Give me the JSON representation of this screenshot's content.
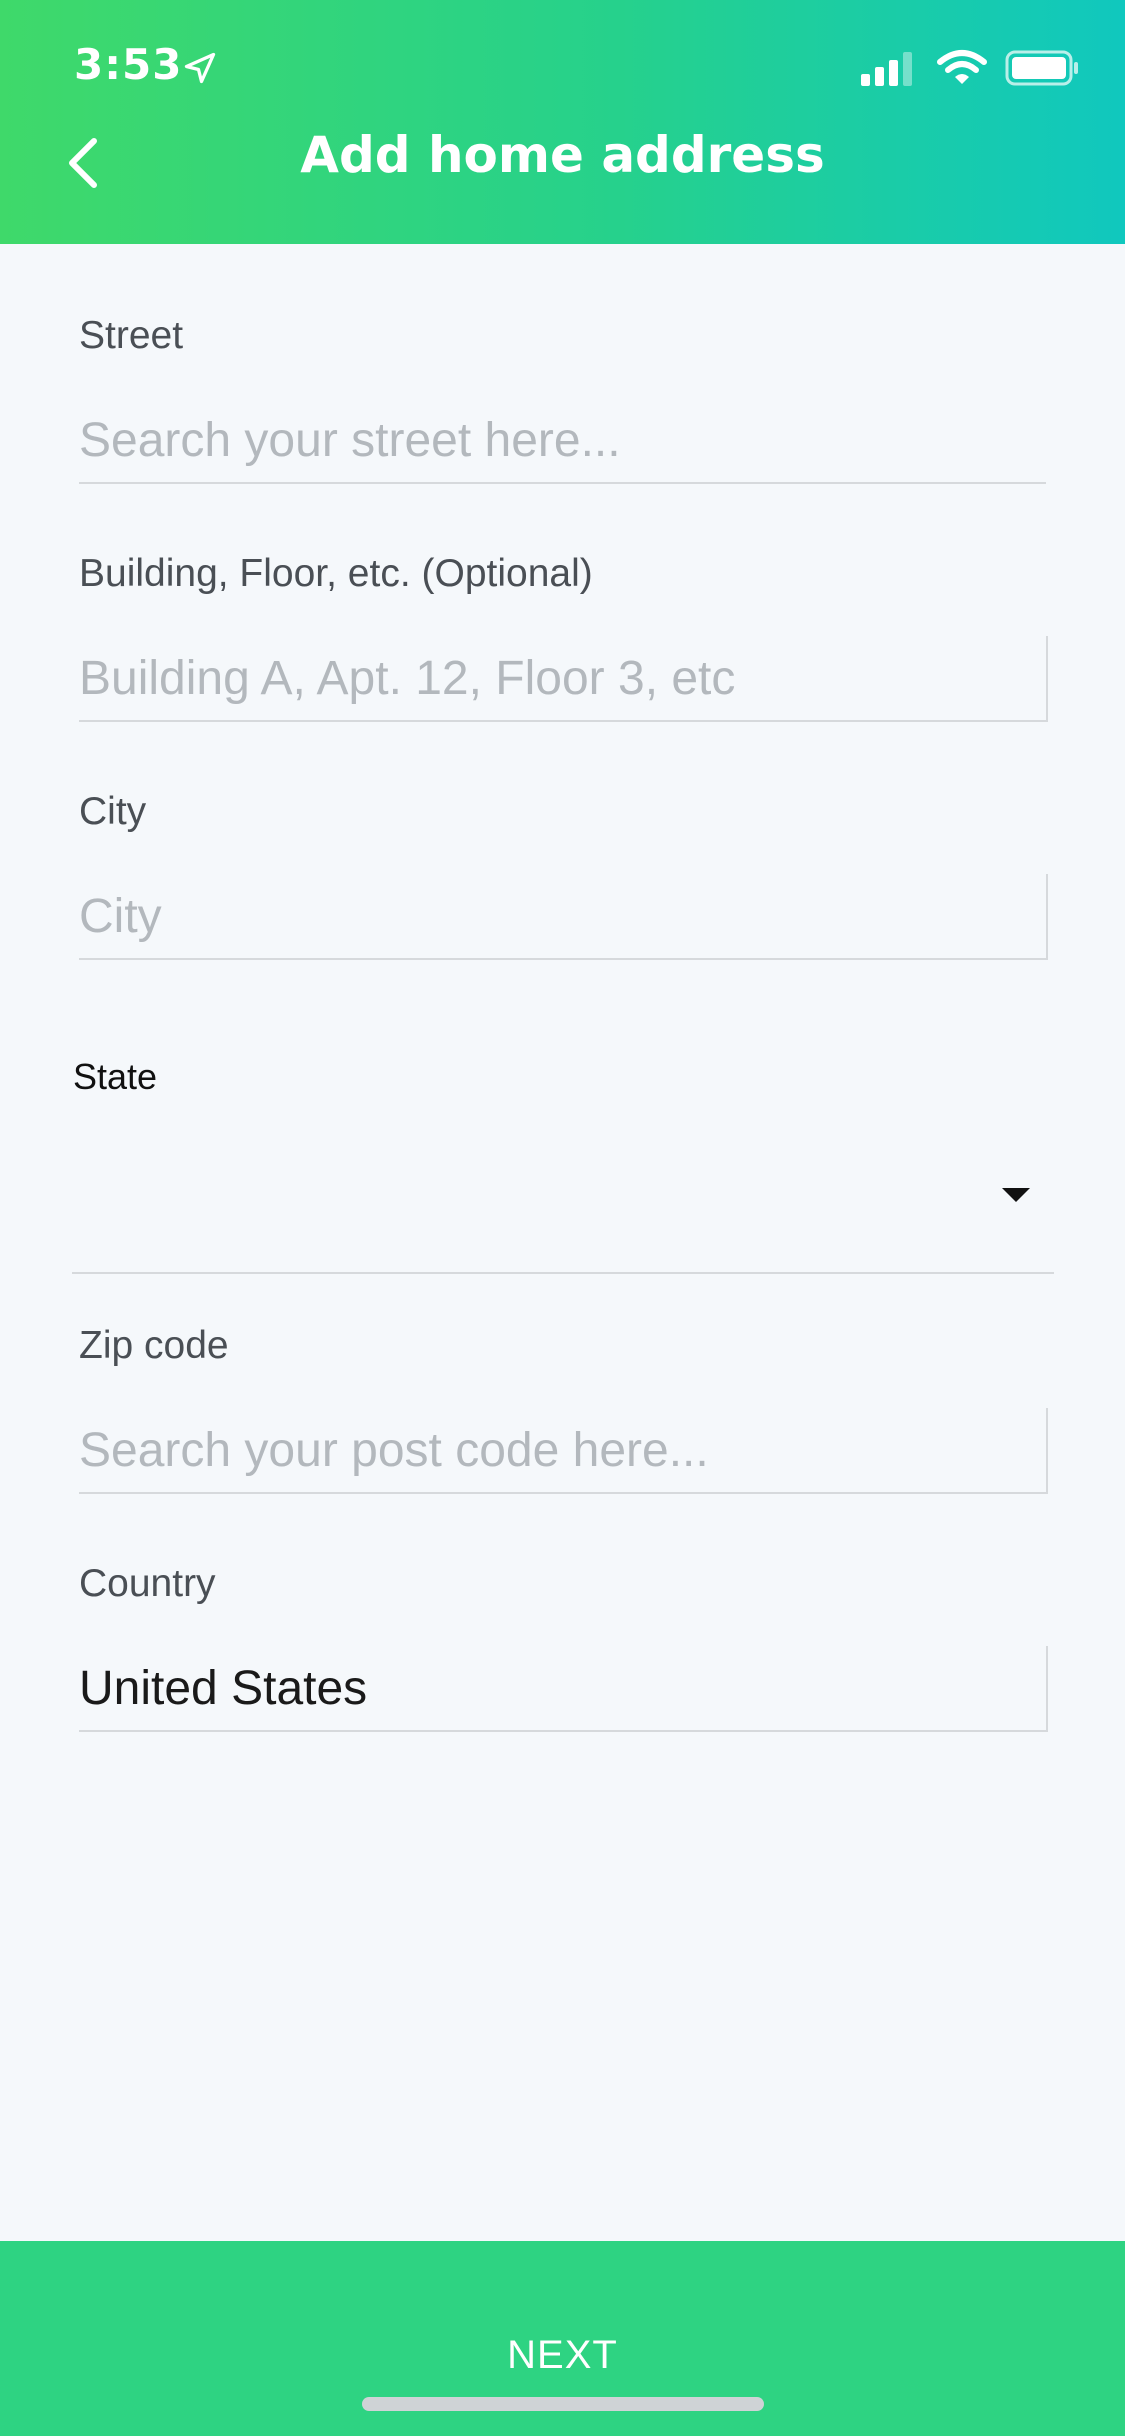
{
  "status_bar": {
    "time": "3:53",
    "icons": [
      "location-arrow-icon",
      "cellular-signal-icon",
      "wifi-icon",
      "battery-icon"
    ]
  },
  "header": {
    "title": "Add home address",
    "back_icon": "chevron-left-icon",
    "gradient_start": "#3fd96a",
    "gradient_end": "#10c8be"
  },
  "form": {
    "street": {
      "label": "Street",
      "placeholder": "Search your street here...",
      "value": ""
    },
    "building": {
      "label": "Building, Floor, etc. (Optional)",
      "placeholder": "Building A, Apt. 12, Floor 3, etc",
      "value": ""
    },
    "city": {
      "label": "City",
      "placeholder": "City",
      "value": ""
    },
    "state": {
      "label": "State",
      "selected": "",
      "dropdown_icon": "caret-down-icon"
    },
    "zip": {
      "label": "Zip code",
      "placeholder": "Search your post code here...",
      "value": ""
    },
    "country": {
      "label": "Country",
      "value": "United States"
    }
  },
  "footer": {
    "next_label": "NEXT",
    "accent_color": "#2ed382"
  }
}
